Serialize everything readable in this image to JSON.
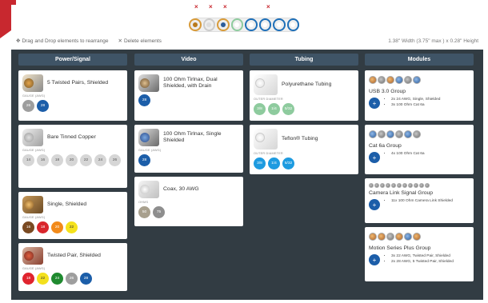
{
  "toolbar": {
    "drag_hint": "Drag and Drop elements to rearrange",
    "delete_hint": "Delete elements",
    "size_readout": "1.38\" Width (3.75\" max ) x 0.28\" Height"
  },
  "colors": {
    "accent": "#1c5ea9",
    "header": "#3f5466",
    "workspace": "#323c43",
    "brand_red": "#c8282f"
  },
  "preview": {
    "remove_marks": [
      "×",
      "×",
      "×",
      "×"
    ]
  },
  "columns": [
    {
      "title": "Power/Signal",
      "cards": [
        {
          "title": "5 Twisted Pairs, Shielded",
          "label": "GAUGE (AWG)",
          "chips": [
            {
              "text": "26",
              "color": "#9e9e9e"
            },
            {
              "text": "28",
              "color": "#1c5ea9"
            }
          ]
        },
        {
          "title": "Bare Tinned Copper",
          "label": "GAUGE (AWG)",
          "chips": [
            {
              "text": "14",
              "color": "#d6d6d6"
            },
            {
              "text": "16",
              "color": "#d6d6d6"
            },
            {
              "text": "18",
              "color": "#d6d6d6"
            },
            {
              "text": "20",
              "color": "#d6d6d6"
            },
            {
              "text": "22",
              "color": "#d6d6d6"
            },
            {
              "text": "24",
              "color": "#d6d6d6"
            },
            {
              "text": "26",
              "color": "#d6d6d6"
            }
          ]
        },
        {
          "title": "Single, Shielded",
          "label": "GAUGE (AWG)",
          "chips": [
            {
              "text": "16",
              "color": "#7a4a22"
            },
            {
              "text": "18",
              "color": "#d9262c"
            },
            {
              "text": "20",
              "color": "#f28a1a"
            },
            {
              "text": "22",
              "color": "#f5e21c"
            }
          ]
        },
        {
          "title": "Twisted Pair, Shielded",
          "label": "GAUGE (AWG)",
          "chips": [
            {
              "text": "18",
              "color": "#e0242e"
            },
            {
              "text": "22",
              "color": "#f3e01d"
            },
            {
              "text": "24",
              "color": "#1f8a2f"
            },
            {
              "text": "26",
              "color": "#9e9e9e"
            },
            {
              "text": "28",
              "color": "#1c5ea9"
            }
          ]
        }
      ]
    },
    {
      "title": "Video",
      "cards": [
        {
          "title": "100 Ohm Tirlnax, Dual Shielded, with Drain",
          "label": "",
          "chips": [
            {
              "text": "28",
              "color": "#1c5ea9"
            }
          ]
        },
        {
          "title": "100 Ohm Tirlnax, Single Shielded",
          "label": "GAUGE (AWG)",
          "chips": [
            {
              "text": "28",
              "color": "#1c5ea9"
            }
          ]
        },
        {
          "title": "Coax, 30 AWG",
          "label": "OHMS",
          "chips": [
            {
              "text": "50",
              "color": "#a8a08e"
            },
            {
              "text": "75",
              "color": "#8e8e8e"
            }
          ]
        }
      ]
    },
    {
      "title": "Tubing",
      "cards": [
        {
          "title": "Polyurethane Tubing",
          "label": "OUTER DIAMETER",
          "chips": [
            {
              "text": "3/8",
              "color": "#8ecb9e"
            },
            {
              "text": "1/4",
              "color": "#8ecb9e"
            },
            {
              "text": "5/32",
              "color": "#8ecb9e"
            }
          ]
        },
        {
          "title": "Teflon® Tubing",
          "label": "OUTER DIAMETER",
          "chips": [
            {
              "text": "3/8",
              "color": "#1e9be0"
            },
            {
              "text": "1/4",
              "color": "#1e9be0"
            },
            {
              "text": "5/32",
              "color": "#1e9be0"
            }
          ]
        }
      ]
    },
    {
      "title": "Modules",
      "modules": [
        {
          "title": "USB 3.0 Group",
          "items": [
            "2x 24 AWG, Single, Shielded",
            "3x 100 Ohm Cat 6a"
          ],
          "add": "+"
        },
        {
          "title": "Cat 6a Group",
          "items": [
            "4x 100 Ohm Cat 6a"
          ],
          "add": "+"
        },
        {
          "title": "Camera Link Signal Group",
          "items": [
            "11x 100 Ohm Camera Link Shielded"
          ],
          "add": "+"
        },
        {
          "title": "Motion Series Plus Group",
          "items": [
            "3x 22 AWG, Twisted Pair, Shielded",
            "2x 28 AWG, 5 Twisted Pair, Shielded"
          ],
          "add": "+"
        }
      ]
    }
  ]
}
